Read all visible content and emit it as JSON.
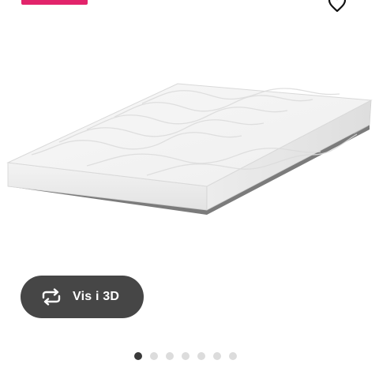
{
  "colors": {
    "promo_badge": "#e2246b",
    "button_bg": "#464646",
    "button_text": "#ffffff",
    "dot_active": "#3a3a3a",
    "dot_inactive": "#dcdcdc",
    "heart_stroke": "#111111"
  },
  "header": {
    "favorite_icon": "heart-outline-icon"
  },
  "gallery": {
    "image_alt": "mattress-image",
    "view_3d_label": "Vis i 3D",
    "view_3d_icon": "rotate-arrows-icon",
    "total_images": 7,
    "active_index": 0
  }
}
